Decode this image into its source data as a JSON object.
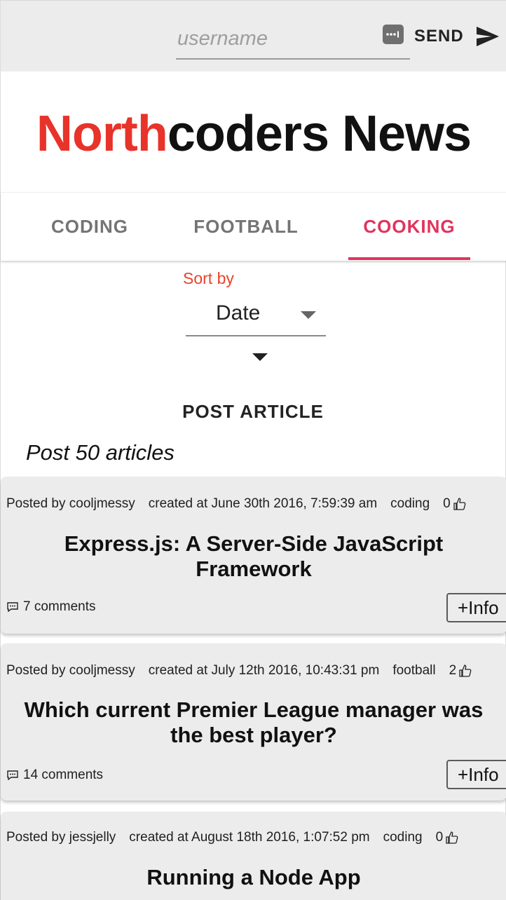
{
  "login": {
    "username_placeholder": "username",
    "username_value": "",
    "password_icon": "password-dots-icon",
    "send_label": "SEND",
    "send_icon": "send-arrow-icon"
  },
  "header": {
    "title_accent": "North",
    "title_rest": "coders News",
    "accent_color": "#e8332a"
  },
  "tabs": [
    {
      "label": "CODING",
      "active": false
    },
    {
      "label": "FOOTBALL",
      "active": false
    },
    {
      "label": "COOKING",
      "active": true
    }
  ],
  "tab_active_color": "#e0335e",
  "sort": {
    "label": "Sort by",
    "selected": "Date",
    "order_icon": "caret-down-icon"
  },
  "post_article_label": "POST ARTICLE",
  "article_count_text": "Post 50 articles",
  "articles": [
    {
      "author": "Posted by cooljmessy",
      "created": "created at June 30th 2016, 7:59:39 am",
      "topic": "coding",
      "votes": "0",
      "title": "Express.js: A Server-Side JavaScript Framework",
      "comments": "7 comments",
      "info_label": "+Info"
    },
    {
      "author": "Posted by cooljmessy",
      "created": "created at July 12th 2016, 10:43:31 pm",
      "topic": "football",
      "votes": "2",
      "title": "Which current Premier League manager was the best player?",
      "comments": "14 comments",
      "info_label": "+Info"
    },
    {
      "author": "Posted by jessjelly",
      "created": "created at August 18th 2016, 1:07:52 pm",
      "topic": "coding",
      "votes": "0",
      "title": "Running a Node App",
      "comments": "",
      "info_label": ""
    }
  ]
}
